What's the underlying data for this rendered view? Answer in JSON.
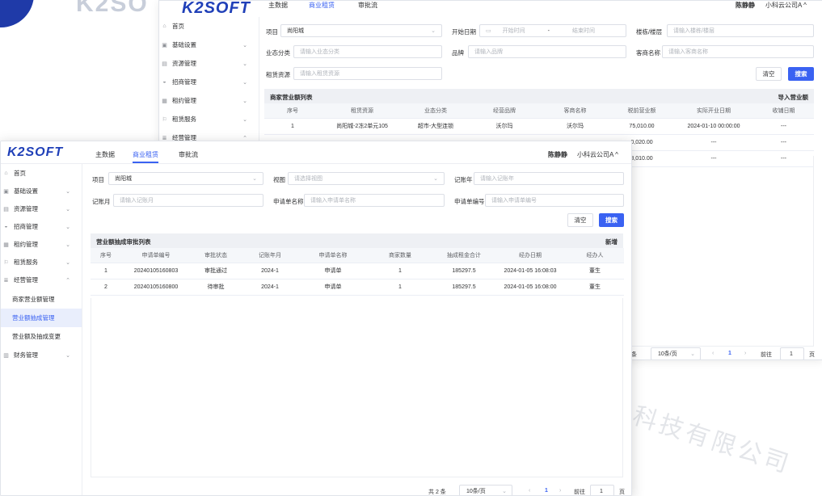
{
  "background": {
    "brand": "K2SO"
  },
  "watermark": "科技有限公司",
  "back": {
    "logo": "K2SOFT",
    "tabs": [
      "主数据",
      "商业租赁",
      "审批流"
    ],
    "active_tab": 1,
    "user": "陈静静",
    "company": "小科云公司A ^",
    "sidebar": [
      "首页",
      "基础设置",
      "资源管理",
      "招商管理",
      "租约管理",
      "租赁服务",
      "经营管理"
    ],
    "filters": {
      "project_label": "项目",
      "project_value": "尚阳城",
      "start_label": "开始日期",
      "start_ph": "开始时间",
      "sep": "-",
      "end_ph": "结束时间",
      "building_label": "楼栋/楼层",
      "building_ph": "请输入楼栋/楼层",
      "format_label": "业态分类",
      "format_ph": "请输入业态分类",
      "brand_label": "品牌",
      "brand_ph": "请输入品牌",
      "customer_label": "客商名称",
      "customer_ph": "请输入客商名称",
      "resource_label": "租赁资源",
      "resource_ph": "请输入租赁资源"
    },
    "clear": "清空",
    "search": "搜索",
    "card_title": "商家营业额列表",
    "card_action": "导入营业额",
    "columns": [
      "序号",
      "租赁资源",
      "业态分类",
      "经营品牌",
      "客商名称",
      "税前营业额",
      "实际开业日期",
      "收铺日期"
    ],
    "rows": [
      [
        "1",
        "尚阳城-2冻2单元105",
        "超市-大型连锁",
        "沃尔玛",
        "沃尔玛",
        "75,010.00",
        "2024-01-10 00:00:00",
        "---"
      ]
    ],
    "extra_values": [
      {
        "amount": "0,020.00",
        "open": "---",
        "close": "---"
      },
      {
        "amount": "8,010.00",
        "open": "---",
        "close": "---"
      }
    ],
    "pager": {
      "total_suffix": "条",
      "size": "10条/页",
      "page": "1",
      "goto": "前往",
      "goto_val": "1",
      "page_unit": "页"
    }
  },
  "front": {
    "logo": "K2SOFT",
    "tabs": [
      "主数据",
      "商业租赁",
      "审批流"
    ],
    "active_tab": 1,
    "user": "陈静静",
    "company": "小科云公司A ^",
    "sidebar": [
      {
        "label": "首页",
        "icon": "home-icon",
        "chev": false
      },
      {
        "label": "基础设置",
        "icon": "settings-icon",
        "chev": true
      },
      {
        "label": "资源管理",
        "icon": "resource-icon",
        "chev": true
      },
      {
        "label": "招商管理",
        "icon": "investment-icon",
        "chev": true
      },
      {
        "label": "租约管理",
        "icon": "lease-icon",
        "chev": true
      },
      {
        "label": "租赁服务",
        "icon": "service-icon",
        "chev": true
      },
      {
        "label": "经营管理",
        "icon": "operation-icon",
        "chev": true,
        "open": true
      }
    ],
    "sub_items": [
      "商家营业额管理",
      "营业额抽成管理",
      "营业额及抽成变更"
    ],
    "active_sub": 1,
    "last_item": "财务管理",
    "filters": {
      "project_label": "项目",
      "project_value": "尚阳城",
      "view_label": "视图",
      "view_ph": "请选择视图",
      "year_label": "记账年",
      "year_ph": "请输入记账年",
      "month_label": "记账月",
      "month_ph": "请输入记账月",
      "form_name_label": "申请单名称",
      "form_name_ph": "请输入申请单名称",
      "form_no_label": "申请单编号",
      "form_no_ph": "请输入申请单编号"
    },
    "clear": "清空",
    "search": "搜索",
    "card_title": "营业额抽成审批列表",
    "card_action": "新增",
    "columns": [
      "序号",
      "申请单编号",
      "审批状态",
      "记账年月",
      "申请单名称",
      "商家数量",
      "抽成租金合计",
      "经办日期",
      "经办人"
    ],
    "rows": [
      [
        "1",
        "20240105160803",
        "审批通过",
        "2024-1",
        "申请单",
        "1",
        "185297.5",
        "2024-01-05 16:08:03",
        "董生"
      ],
      [
        "2",
        "20240105160800",
        "待审批",
        "2024-1",
        "申请单",
        "1",
        "185297.5",
        "2024-01-05 16:08:00",
        "董生"
      ]
    ],
    "pager": {
      "total": "共 2 条",
      "size": "10条/页",
      "page": "1",
      "goto": "前往",
      "goto_val": "1",
      "page_unit": "页"
    }
  }
}
